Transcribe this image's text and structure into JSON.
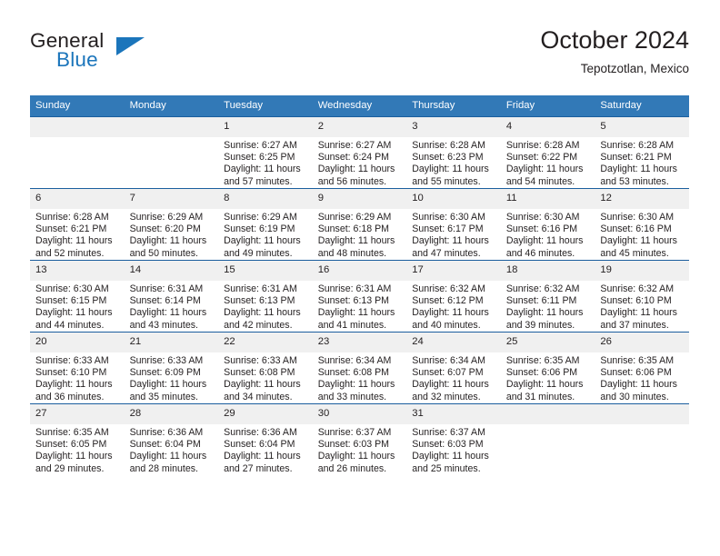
{
  "logo": {
    "word_top": "General",
    "word_bottom": "Blue",
    "accent_color": "#1b75bb"
  },
  "header": {
    "title": "October 2024",
    "subtitle": "Tepotzotlan, Mexico"
  },
  "theme": {
    "header_bg": "#3279b7",
    "header_text": "#ffffff",
    "row_border": "#1b5e9e",
    "daynum_bg": "#f0f0f0",
    "body_text": "#231f20"
  },
  "calendar": {
    "weekday_headers": [
      "Sunday",
      "Monday",
      "Tuesday",
      "Wednesday",
      "Thursday",
      "Friday",
      "Saturday"
    ],
    "weeks": [
      [
        {
          "day": "",
          "blank": true
        },
        {
          "day": "",
          "blank": true
        },
        {
          "day": "1",
          "sunrise": "Sunrise: 6:27 AM",
          "sunset": "Sunset: 6:25 PM",
          "daylight": "Daylight: 11 hours and 57 minutes."
        },
        {
          "day": "2",
          "sunrise": "Sunrise: 6:27 AM",
          "sunset": "Sunset: 6:24 PM",
          "daylight": "Daylight: 11 hours and 56 minutes."
        },
        {
          "day": "3",
          "sunrise": "Sunrise: 6:28 AM",
          "sunset": "Sunset: 6:23 PM",
          "daylight": "Daylight: 11 hours and 55 minutes."
        },
        {
          "day": "4",
          "sunrise": "Sunrise: 6:28 AM",
          "sunset": "Sunset: 6:22 PM",
          "daylight": "Daylight: 11 hours and 54 minutes."
        },
        {
          "day": "5",
          "sunrise": "Sunrise: 6:28 AM",
          "sunset": "Sunset: 6:21 PM",
          "daylight": "Daylight: 11 hours and 53 minutes."
        }
      ],
      [
        {
          "day": "6",
          "sunrise": "Sunrise: 6:28 AM",
          "sunset": "Sunset: 6:21 PM",
          "daylight": "Daylight: 11 hours and 52 minutes."
        },
        {
          "day": "7",
          "sunrise": "Sunrise: 6:29 AM",
          "sunset": "Sunset: 6:20 PM",
          "daylight": "Daylight: 11 hours and 50 minutes."
        },
        {
          "day": "8",
          "sunrise": "Sunrise: 6:29 AM",
          "sunset": "Sunset: 6:19 PM",
          "daylight": "Daylight: 11 hours and 49 minutes."
        },
        {
          "day": "9",
          "sunrise": "Sunrise: 6:29 AM",
          "sunset": "Sunset: 6:18 PM",
          "daylight": "Daylight: 11 hours and 48 minutes."
        },
        {
          "day": "10",
          "sunrise": "Sunrise: 6:30 AM",
          "sunset": "Sunset: 6:17 PM",
          "daylight": "Daylight: 11 hours and 47 minutes."
        },
        {
          "day": "11",
          "sunrise": "Sunrise: 6:30 AM",
          "sunset": "Sunset: 6:16 PM",
          "daylight": "Daylight: 11 hours and 46 minutes."
        },
        {
          "day": "12",
          "sunrise": "Sunrise: 6:30 AM",
          "sunset": "Sunset: 6:16 PM",
          "daylight": "Daylight: 11 hours and 45 minutes."
        }
      ],
      [
        {
          "day": "13",
          "sunrise": "Sunrise: 6:30 AM",
          "sunset": "Sunset: 6:15 PM",
          "daylight": "Daylight: 11 hours and 44 minutes."
        },
        {
          "day": "14",
          "sunrise": "Sunrise: 6:31 AM",
          "sunset": "Sunset: 6:14 PM",
          "daylight": "Daylight: 11 hours and 43 minutes."
        },
        {
          "day": "15",
          "sunrise": "Sunrise: 6:31 AM",
          "sunset": "Sunset: 6:13 PM",
          "daylight": "Daylight: 11 hours and 42 minutes."
        },
        {
          "day": "16",
          "sunrise": "Sunrise: 6:31 AM",
          "sunset": "Sunset: 6:13 PM",
          "daylight": "Daylight: 11 hours and 41 minutes."
        },
        {
          "day": "17",
          "sunrise": "Sunrise: 6:32 AM",
          "sunset": "Sunset: 6:12 PM",
          "daylight": "Daylight: 11 hours and 40 minutes."
        },
        {
          "day": "18",
          "sunrise": "Sunrise: 6:32 AM",
          "sunset": "Sunset: 6:11 PM",
          "daylight": "Daylight: 11 hours and 39 minutes."
        },
        {
          "day": "19",
          "sunrise": "Sunrise: 6:32 AM",
          "sunset": "Sunset: 6:10 PM",
          "daylight": "Daylight: 11 hours and 37 minutes."
        }
      ],
      [
        {
          "day": "20",
          "sunrise": "Sunrise: 6:33 AM",
          "sunset": "Sunset: 6:10 PM",
          "daylight": "Daylight: 11 hours and 36 minutes."
        },
        {
          "day": "21",
          "sunrise": "Sunrise: 6:33 AM",
          "sunset": "Sunset: 6:09 PM",
          "daylight": "Daylight: 11 hours and 35 minutes."
        },
        {
          "day": "22",
          "sunrise": "Sunrise: 6:33 AM",
          "sunset": "Sunset: 6:08 PM",
          "daylight": "Daylight: 11 hours and 34 minutes."
        },
        {
          "day": "23",
          "sunrise": "Sunrise: 6:34 AM",
          "sunset": "Sunset: 6:08 PM",
          "daylight": "Daylight: 11 hours and 33 minutes."
        },
        {
          "day": "24",
          "sunrise": "Sunrise: 6:34 AM",
          "sunset": "Sunset: 6:07 PM",
          "daylight": "Daylight: 11 hours and 32 minutes."
        },
        {
          "day": "25",
          "sunrise": "Sunrise: 6:35 AM",
          "sunset": "Sunset: 6:06 PM",
          "daylight": "Daylight: 11 hours and 31 minutes."
        },
        {
          "day": "26",
          "sunrise": "Sunrise: 6:35 AM",
          "sunset": "Sunset: 6:06 PM",
          "daylight": "Daylight: 11 hours and 30 minutes."
        }
      ],
      [
        {
          "day": "27",
          "sunrise": "Sunrise: 6:35 AM",
          "sunset": "Sunset: 6:05 PM",
          "daylight": "Daylight: 11 hours and 29 minutes."
        },
        {
          "day": "28",
          "sunrise": "Sunrise: 6:36 AM",
          "sunset": "Sunset: 6:04 PM",
          "daylight": "Daylight: 11 hours and 28 minutes."
        },
        {
          "day": "29",
          "sunrise": "Sunrise: 6:36 AM",
          "sunset": "Sunset: 6:04 PM",
          "daylight": "Daylight: 11 hours and 27 minutes."
        },
        {
          "day": "30",
          "sunrise": "Sunrise: 6:37 AM",
          "sunset": "Sunset: 6:03 PM",
          "daylight": "Daylight: 11 hours and 26 minutes."
        },
        {
          "day": "31",
          "sunrise": "Sunrise: 6:37 AM",
          "sunset": "Sunset: 6:03 PM",
          "daylight": "Daylight: 11 hours and 25 minutes."
        },
        {
          "day": "",
          "blank": true
        },
        {
          "day": "",
          "blank": true
        }
      ]
    ]
  }
}
